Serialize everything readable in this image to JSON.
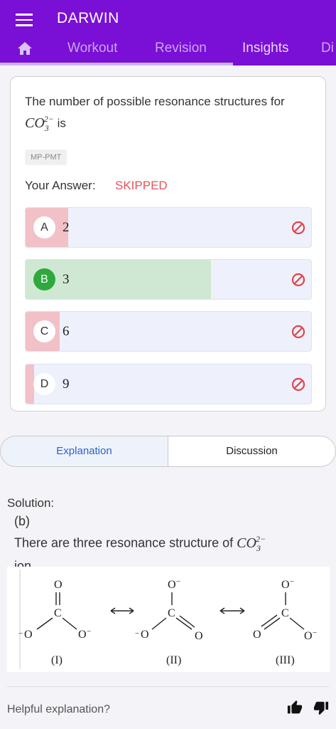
{
  "app": {
    "title": "DARWIN"
  },
  "tabs": [
    {
      "label": "Workout"
    },
    {
      "label": "Revision"
    },
    {
      "label": "Insights"
    },
    {
      "label": "Di"
    }
  ],
  "question": {
    "text_prefix": "The number of possible resonance structures for ",
    "formula_base": "CO",
    "formula_sub": "3",
    "formula_sup": "2−",
    "text_suffix": " is",
    "tag": "MP-PMT",
    "answer_label": "Your Answer:",
    "answer_value": "SKIPPED",
    "options": [
      {
        "letter": "A",
        "text": "2",
        "fill_fraction": 0.15,
        "fill_color": "#f2c1c8",
        "correct": false
      },
      {
        "letter": "B",
        "text": "3",
        "fill_fraction": 0.65,
        "fill_color": "#cfe8d3",
        "correct": true
      },
      {
        "letter": "C",
        "text": "6",
        "fill_fraction": 0.12,
        "fill_color": "#f2c1c8",
        "correct": false
      },
      {
        "letter": "D",
        "text": "9",
        "fill_fraction": 0.03,
        "fill_color": "#f2c1c8",
        "correct": false
      }
    ]
  },
  "segments": {
    "left": "Explanation",
    "right": "Discussion"
  },
  "solution": {
    "heading": "Solution:",
    "answer": "(b)",
    "text_prefix": "There are three resonance structure of ",
    "formula_base": "CO",
    "formula_sub": "3",
    "formula_sup": "2−",
    "text_suffix": "ion.",
    "figure_labels": [
      "(I)",
      "(II)",
      "(III)"
    ],
    "atom_O": "O",
    "atom_C": "C",
    "charge_minus": "−"
  },
  "feedback": {
    "prompt": "Helpful explanation?"
  },
  "colors": {
    "brand": "#7a0fd6",
    "skipped": "#e8535a",
    "correct": "#2fa83e",
    "wrong_icon": "#e0454b"
  }
}
